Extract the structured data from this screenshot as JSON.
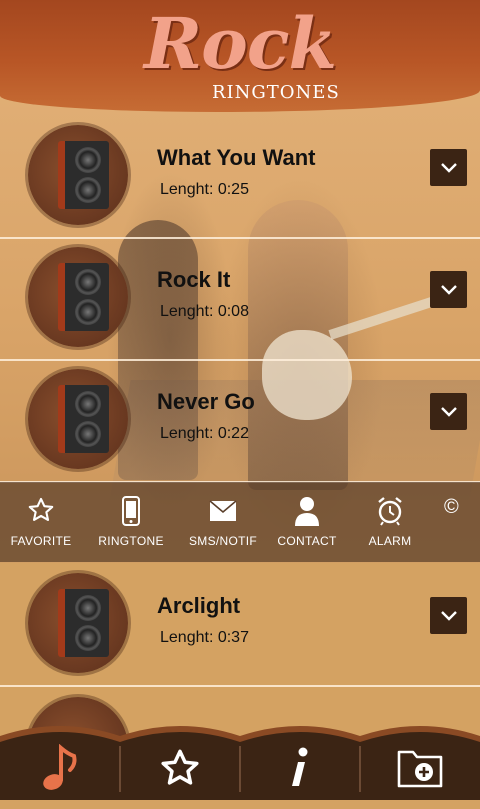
{
  "header": {
    "logo_main": "Rock",
    "logo_sub": "RINGTONES"
  },
  "songs": [
    {
      "title": "What You Want",
      "length": "Lenght: 0:25"
    },
    {
      "title": "Rock It",
      "length": "Lenght: 0:08"
    },
    {
      "title": "Never Go",
      "length": "Lenght: 0:22"
    },
    {
      "title": "Arclight",
      "length": "Lenght: 0:37"
    }
  ],
  "actions": {
    "favorite": "FAVORITE",
    "ringtone": "RINGTONE",
    "sms": "SMS/NOTIF",
    "contact": "CONTACT",
    "alarm": "ALARM",
    "copyright": "©"
  },
  "colors": {
    "header": "#b85626",
    "logo": "#f2a28a",
    "accent_note": "#e8734a",
    "nav_bg": "#3b2414"
  }
}
